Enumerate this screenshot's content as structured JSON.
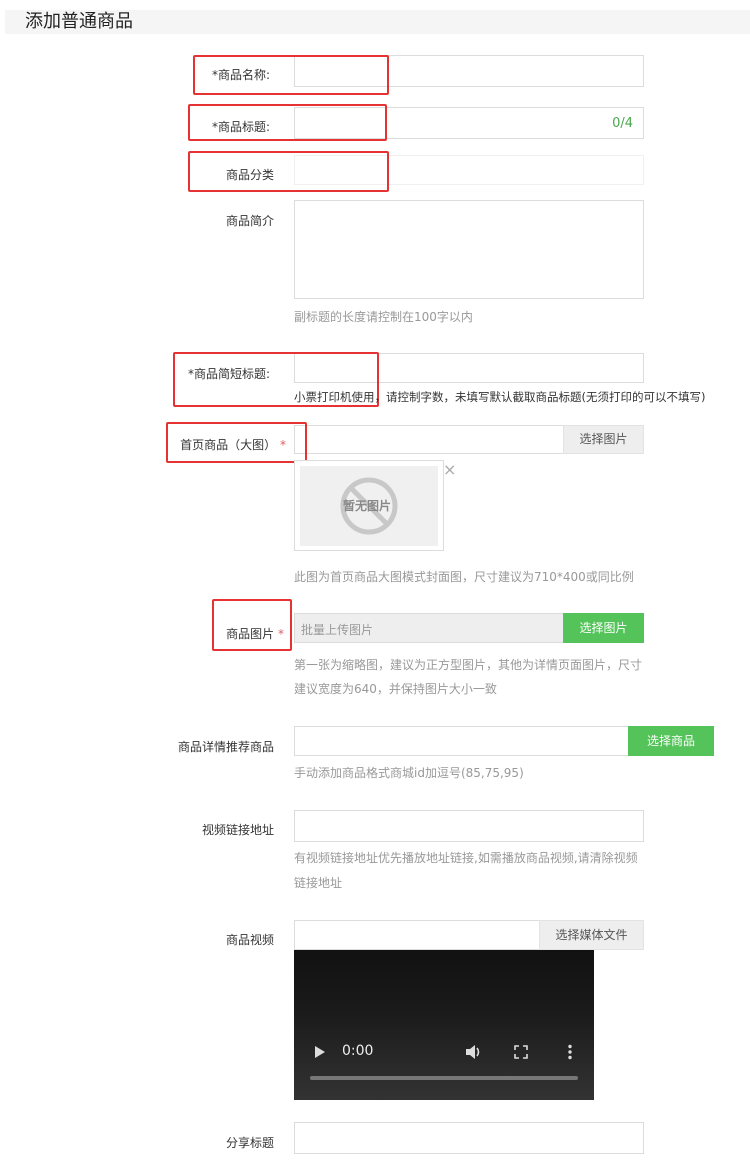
{
  "page": {
    "title": "添加普通商品"
  },
  "form": {
    "name": {
      "label": "*商品名称:",
      "value": ""
    },
    "title": {
      "label": "*商品标题:",
      "value": "",
      "counter": "0/4"
    },
    "category": {
      "label": "商品分类",
      "value": ""
    },
    "intro": {
      "label": "商品简介",
      "value": "",
      "hint": "副标题的长度请控制在100字以内"
    },
    "short_title": {
      "label": "*商品简短标题:",
      "value": "",
      "hint": "小票打印机使用，请控制字数，未填写默认截取商品标题(无须打印的可以不填写)"
    },
    "home_image": {
      "label": "首页商品（大图）",
      "star": "*",
      "value": "",
      "button": "选择图片",
      "placeholder_text": "暂无图片",
      "close": "×",
      "hint": "此图为首页商品大图模式封面图，尺寸建议为710*400或同比例"
    },
    "product_images": {
      "label": "商品图片",
      "star": "*",
      "placeholder": "批量上传图片",
      "button": "选择图片",
      "hint_line1": "第一张为缩略图，建议为正方型图片，其他为详情页面图片，尺寸",
      "hint_line2": "建议宽度为640，并保持图片大小一致"
    },
    "recommend": {
      "label": "商品详情推荐商品",
      "value": "",
      "button": "选择商品",
      "hint": "手动添加商品格式商城id加逗号(85,75,95)"
    },
    "video_link": {
      "label": "视频链接地址",
      "value": "",
      "hint_line1": "有视频链接地址优先播放地址链接,如需播放商品视频,请清除视频",
      "hint_line2": "链接地址"
    },
    "video": {
      "label": "商品视频",
      "value": "",
      "button": "选择媒体文件",
      "time": "0:00"
    },
    "share_title": {
      "label": "分享标题",
      "value": ""
    }
  },
  "colors": {
    "accent_green": "#54c45a",
    "highlight_red": "#e53333",
    "counter_green": "#4aa84f"
  }
}
